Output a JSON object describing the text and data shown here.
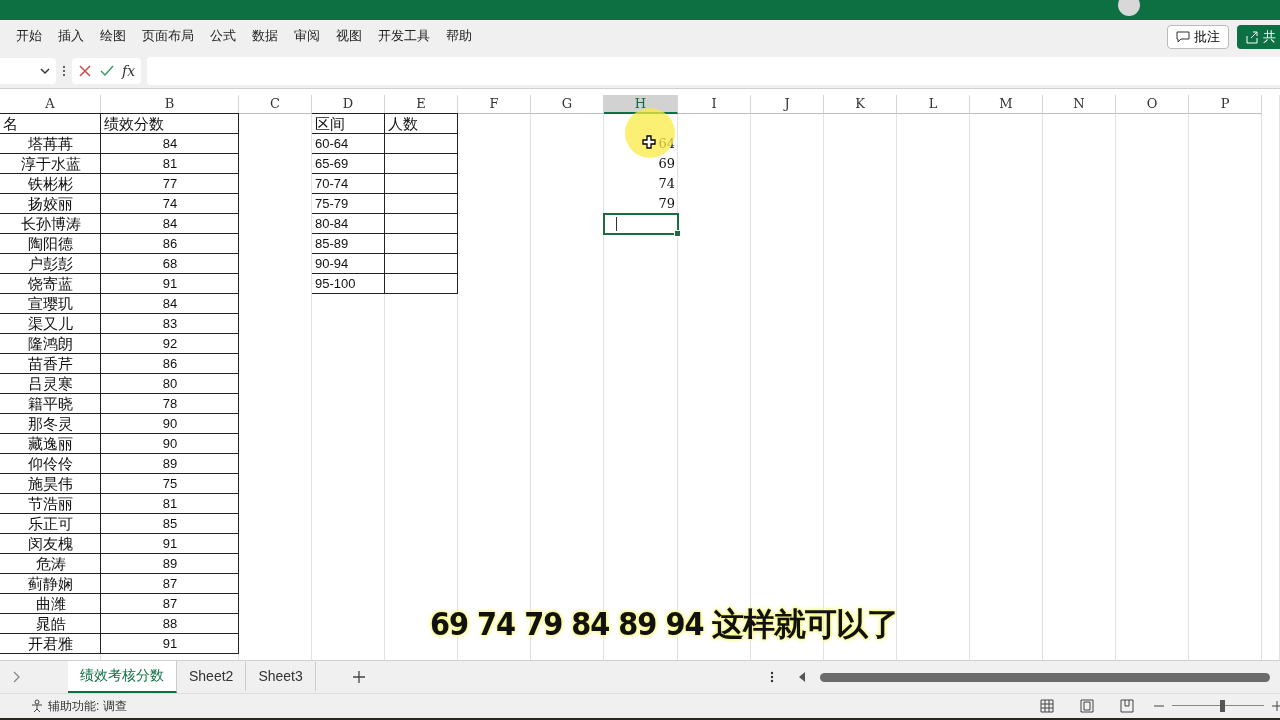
{
  "ribbon_tabs": [
    {
      "label": "开始",
      "selected": false
    },
    {
      "label": "插入",
      "selected": false
    },
    {
      "label": "绘图",
      "selected": false
    },
    {
      "label": "页面布局",
      "selected": false
    },
    {
      "label": "公式",
      "selected": false
    },
    {
      "label": "数据",
      "selected": false
    },
    {
      "label": "审阅",
      "selected": false
    },
    {
      "label": "视图",
      "selected": false
    },
    {
      "label": "开发工具",
      "selected": false
    },
    {
      "label": "帮助",
      "selected": false
    }
  ],
  "comment_button": "批注",
  "share_button": "共",
  "formula_bar": {
    "function_label": "fx"
  },
  "columns": [
    {
      "label": "A",
      "selected": false
    },
    {
      "label": "B",
      "selected": false
    },
    {
      "label": "C",
      "selected": false
    },
    {
      "label": "D",
      "selected": false
    },
    {
      "label": "E",
      "selected": false
    },
    {
      "label": "F",
      "selected": false
    },
    {
      "label": "G",
      "selected": false
    },
    {
      "label": "H",
      "selected": true
    },
    {
      "label": "I",
      "selected": false
    },
    {
      "label": "J",
      "selected": false
    },
    {
      "label": "K",
      "selected": false
    },
    {
      "label": "L",
      "selected": false
    },
    {
      "label": "M",
      "selected": false
    },
    {
      "label": "N",
      "selected": false
    },
    {
      "label": "O",
      "selected": false
    },
    {
      "label": "P",
      "selected": false
    }
  ],
  "scores_table": {
    "headers": [
      "名",
      "绩效分数"
    ],
    "rows": [
      [
        "塔苒苒",
        "84"
      ],
      [
        "淳于水蓝",
        "81"
      ],
      [
        "铁彬彬",
        "77"
      ],
      [
        "扬姣丽",
        "74"
      ],
      [
        "长孙博涛",
        "84"
      ],
      [
        "陶阳德",
        "86"
      ],
      [
        "户彭彭",
        "68"
      ],
      [
        "饶寄蓝",
        "91"
      ],
      [
        "宣璎玑",
        "84"
      ],
      [
        "渠又儿",
        "83"
      ],
      [
        "隆鸿朗",
        "92"
      ],
      [
        "苗香芹",
        "86"
      ],
      [
        "吕灵寒",
        "80"
      ],
      [
        "籍平晓",
        "78"
      ],
      [
        "那冬灵",
        "90"
      ],
      [
        "藏逸丽",
        "90"
      ],
      [
        "仰伶伶",
        "89"
      ],
      [
        "施昊伟",
        "75"
      ],
      [
        "节浩丽",
        "81"
      ],
      [
        "乐正可",
        "85"
      ],
      [
        "闵友槐",
        "91"
      ],
      [
        "危涛",
        "89"
      ],
      [
        "蓟静娴",
        "87"
      ],
      [
        "曲潍",
        "87"
      ],
      [
        "晁皓",
        "88"
      ],
      [
        "开君雅",
        "91"
      ]
    ]
  },
  "ranges_table": {
    "headers": [
      "区间",
      "人数"
    ],
    "rows": [
      [
        "60-64"
      ],
      [
        "65-69"
      ],
      [
        "70-74"
      ],
      [
        "75-79"
      ],
      [
        "80-84"
      ],
      [
        "85-89"
      ],
      [
        "90-94"
      ],
      [
        "95-100"
      ]
    ]
  },
  "column_h_cells": [
    {
      "text": "64",
      "selected": false
    },
    {
      "text": "69",
      "selected": false
    },
    {
      "text": "74",
      "selected": false
    },
    {
      "text": "79",
      "selected": false
    },
    {
      "selected": true
    }
  ],
  "sheet_tabs": [
    {
      "label": "绩效考核分数",
      "selected": true
    },
    {
      "label": "Sheet2",
      "selected": false
    },
    {
      "label": "Sheet3",
      "selected": false
    }
  ],
  "status_bar": {
    "accessibility": "辅助功能: 调查",
    "zoom_slider": {
      "level": 0.54
    }
  },
  "caption": "69 74 79 84 89 94 这样就可以了"
}
